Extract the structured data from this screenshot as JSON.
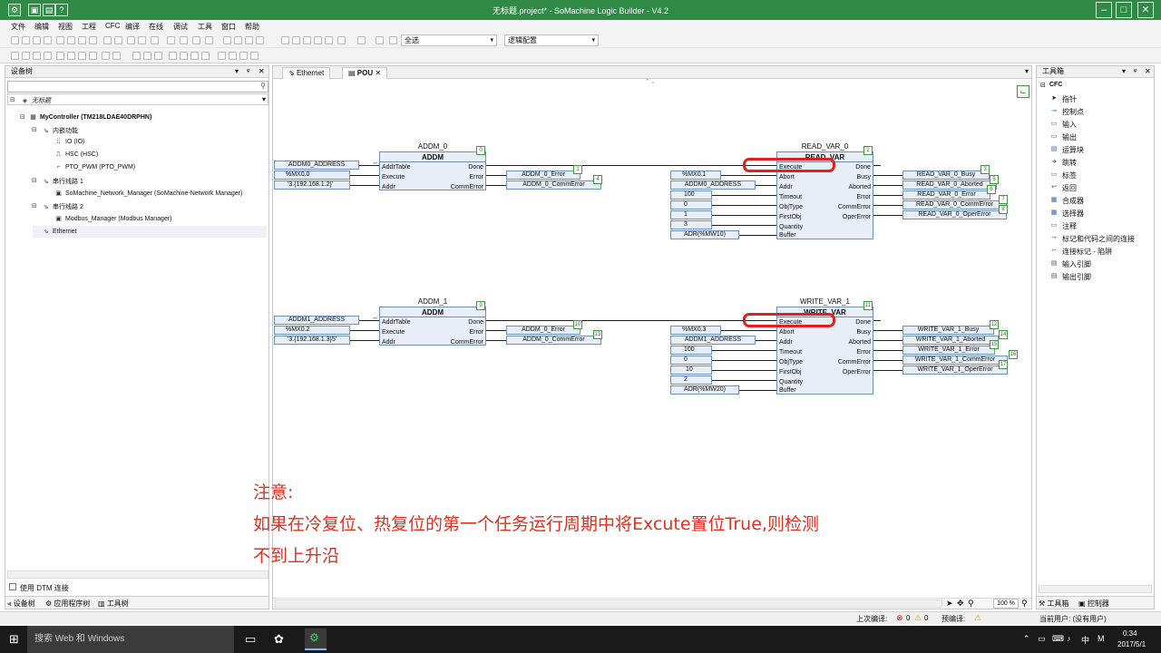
{
  "window": {
    "title": "无标题.project* - SoMachine Logic Builder - V4.2"
  },
  "colors": {
    "title_green": "#2f8a46",
    "highlight_red": "#e0201b",
    "note_red": "#e0301f"
  },
  "menu": [
    "文件",
    "编辑",
    "视图",
    "工程",
    "CFC",
    "编译",
    "在线",
    "调试",
    "工具",
    "窗口",
    "帮助"
  ],
  "toolbar": {
    "select_all": "全选",
    "logic_config": "逻辑配置"
  },
  "left_panel": {
    "title": "设备树",
    "tree": [
      {
        "label": "无标题",
        "icon": "project-icon"
      },
      {
        "label": "MyController (TM218LDAE40DRPHN)",
        "icon": "controller-icon"
      },
      {
        "label": "内嵌功能",
        "icon": "embedded-icon"
      },
      {
        "label": "IO (IO)",
        "icon": "io-icon"
      },
      {
        "label": "HSC (HSC)",
        "icon": "hsc-icon"
      },
      {
        "label": "PTO_PWM (PTO_PWM)",
        "icon": "pto-icon"
      },
      {
        "label": "串行线路 1",
        "icon": "serial-icon"
      },
      {
        "label": "SoMachine_Network_Manager (SoMachine-Network Manager)",
        "icon": "manager-icon"
      },
      {
        "label": "串行线路 2",
        "icon": "serial-icon"
      },
      {
        "label": "Modbus_Manager (Modbus Manager)",
        "icon": "manager-icon"
      },
      {
        "label": "Ethernet",
        "icon": "ethernet-icon"
      }
    ],
    "dtm_checkbox": "使用 DTM 连接",
    "bottom_tabs": [
      "设备树",
      "应用程序树",
      "工具树"
    ]
  },
  "editor": {
    "tabs": [
      "Ethernet",
      "POU"
    ],
    "zoom": "100 %",
    "note": {
      "line1": "注意:",
      "line2": "如果在冷复位、热复位的第一个任务运行周期中将Excute置位True,则检测",
      "line3": "不到上升沿"
    },
    "addm0": {
      "instance": "ADDM_0",
      "type": "ADDM",
      "order": "0",
      "in_pins": [
        "AddrTable",
        "Execute",
        "Addr"
      ],
      "out_pins": [
        "Done",
        "Error",
        "CommError"
      ],
      "inputs": [
        "ADDM0_ADDRESS",
        "%MX0.0",
        "'3.{192.168.1.2}'"
      ],
      "outputs": [
        "ADDM_0_Error",
        "ADDM_0_CommError"
      ],
      "out_nums": [
        "1",
        "4"
      ]
    },
    "read": {
      "instance": "READ_VAR_0",
      "type": "READ_VAR",
      "order": "2",
      "in_pins": [
        "Execute",
        "Abort",
        "Addr",
        "Timeout",
        "ObjType",
        "FirstObj",
        "Quantity",
        "Buffer"
      ],
      "out_pins": [
        "Done",
        "Busy",
        "Aborted",
        "Error",
        "CommError",
        "OperError"
      ],
      "inputs": [
        "%MX0.1",
        "ADDM0_ADDRESS",
        "100",
        "0",
        "1",
        "3",
        "ADR(%MW10)"
      ],
      "outputs": [
        "READ_VAR_0_Busy",
        "READ_VAR_0_Aborted",
        "READ_VAR_0_Error",
        "READ_VAR_0_CommError",
        "READ_VAR_0_OperError"
      ],
      "out_nums": [
        "3",
        "5",
        "6",
        "7",
        "8"
      ]
    },
    "addm1": {
      "instance": "ADDM_1",
      "type": "ADDM",
      "order": "9",
      "in_pins": [
        "AddrTable",
        "Execute",
        "Addr"
      ],
      "out_pins": [
        "Done",
        "Error",
        "CommError"
      ],
      "inputs": [
        "ADDM1_ADDRESS",
        "%MX0.2",
        "'3.{192.168.1.3}5'"
      ],
      "outputs": [
        "ADDM_0_Error",
        "ADDM_0_CommError"
      ],
      "out_nums": [
        "10",
        "13"
      ]
    },
    "write": {
      "instance": "WRITE_VAR_1",
      "type": "WRITE_VAR",
      "order": "11",
      "in_pins": [
        "Execute",
        "Abort",
        "Addr",
        "Timeout",
        "ObjType",
        "FirstObj",
        "Quantity",
        "Buffer"
      ],
      "out_pins": [
        "Done",
        "Busy",
        "Aborted",
        "Error",
        "CommError",
        "OperError"
      ],
      "inputs": [
        "%MX0.3",
        "ADDM1_ADDRESS",
        "100",
        "0",
        "10",
        "2",
        "ADR(%MW20)"
      ],
      "outputs": [
        "WRITE_VAR_1_Busy",
        "WRITE_VAR_1_Aborted",
        "WRITE_VAR_1_Error",
        "WRITE_VAR_1_CommError",
        "WRITE_VAR_1_OperError"
      ],
      "out_nums": [
        "12",
        "14",
        "15",
        "16",
        "17"
      ]
    }
  },
  "toolbox": {
    "title": "工具箱",
    "category": "CFC",
    "items": [
      "指针",
      "控制点",
      "输入",
      "输出",
      "运算块",
      "跳转",
      "标签",
      "返回",
      "合成器",
      "选择器",
      "注释",
      "标记和代码之间的连接",
      "连接标记 - 陷阱",
      "输入引脚",
      "输出引脚"
    ],
    "bottom_tabs": [
      "工具箱",
      "控制器"
    ]
  },
  "status": {
    "last_build": "上次编译:",
    "errors": "0",
    "warnings": "0",
    "precompile": "预编译:",
    "user": "当前用户: (没有用户)"
  },
  "taskbar": {
    "search": "搜索 Web 和 Windows",
    "ime": "中",
    "time": "0:34",
    "date": "2017/5/1"
  }
}
